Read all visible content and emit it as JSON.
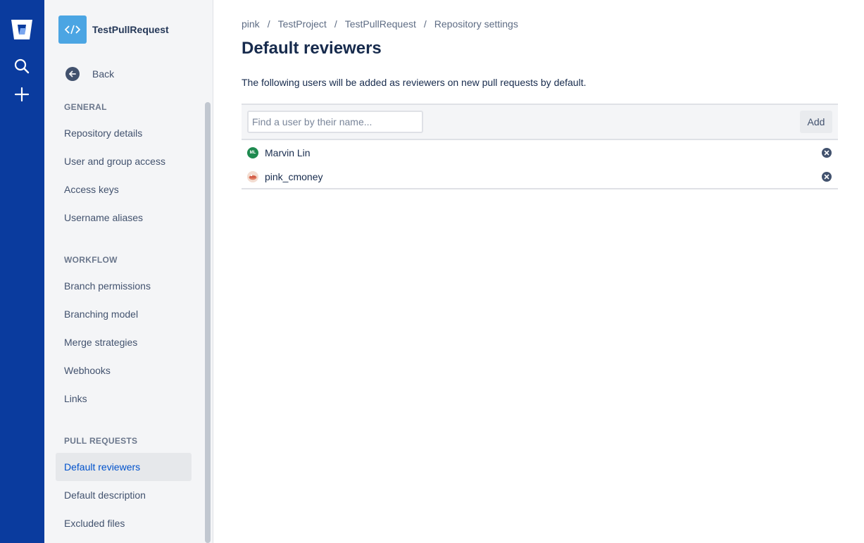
{
  "global_nav": {
    "logo_icon": "bitbucket-logo-icon",
    "items": [
      {
        "icon": "search-icon"
      },
      {
        "icon": "plus-icon"
      }
    ],
    "colors": {
      "background": "#0a3b9e"
    }
  },
  "sidebar": {
    "repo_name": "TestPullRequest",
    "repo_icon": "code-icon",
    "back_label": "Back",
    "sections": [
      {
        "title": "GENERAL",
        "items": [
          "Repository details",
          "User and group access",
          "Access keys",
          "Username aliases"
        ]
      },
      {
        "title": "WORKFLOW",
        "items": [
          "Branch permissions",
          "Branching model",
          "Merge strategies",
          "Webhooks",
          "Links"
        ]
      },
      {
        "title": "PULL REQUESTS",
        "items": [
          "Default reviewers",
          "Default description",
          "Excluded files"
        ]
      }
    ],
    "selected_item": "Default reviewers"
  },
  "breadcrumb": [
    "pink",
    "TestProject",
    "TestPullRequest",
    "Repository settings"
  ],
  "breadcrumb_separator": "/",
  "page": {
    "title": "Default reviewers",
    "description": "The following users will be added as reviewers on new pull requests by default."
  },
  "reviewers_panel": {
    "search": {
      "value": "",
      "placeholder": "Find a user by their name..."
    },
    "add_label": "Add",
    "reviewers": [
      {
        "name": "Marvin Lin",
        "initials": "ML",
        "avatar_color": "#1e8a4f"
      },
      {
        "name": "pink_cmoney",
        "initials": "",
        "avatar_color": "#e07a5f"
      }
    ]
  }
}
